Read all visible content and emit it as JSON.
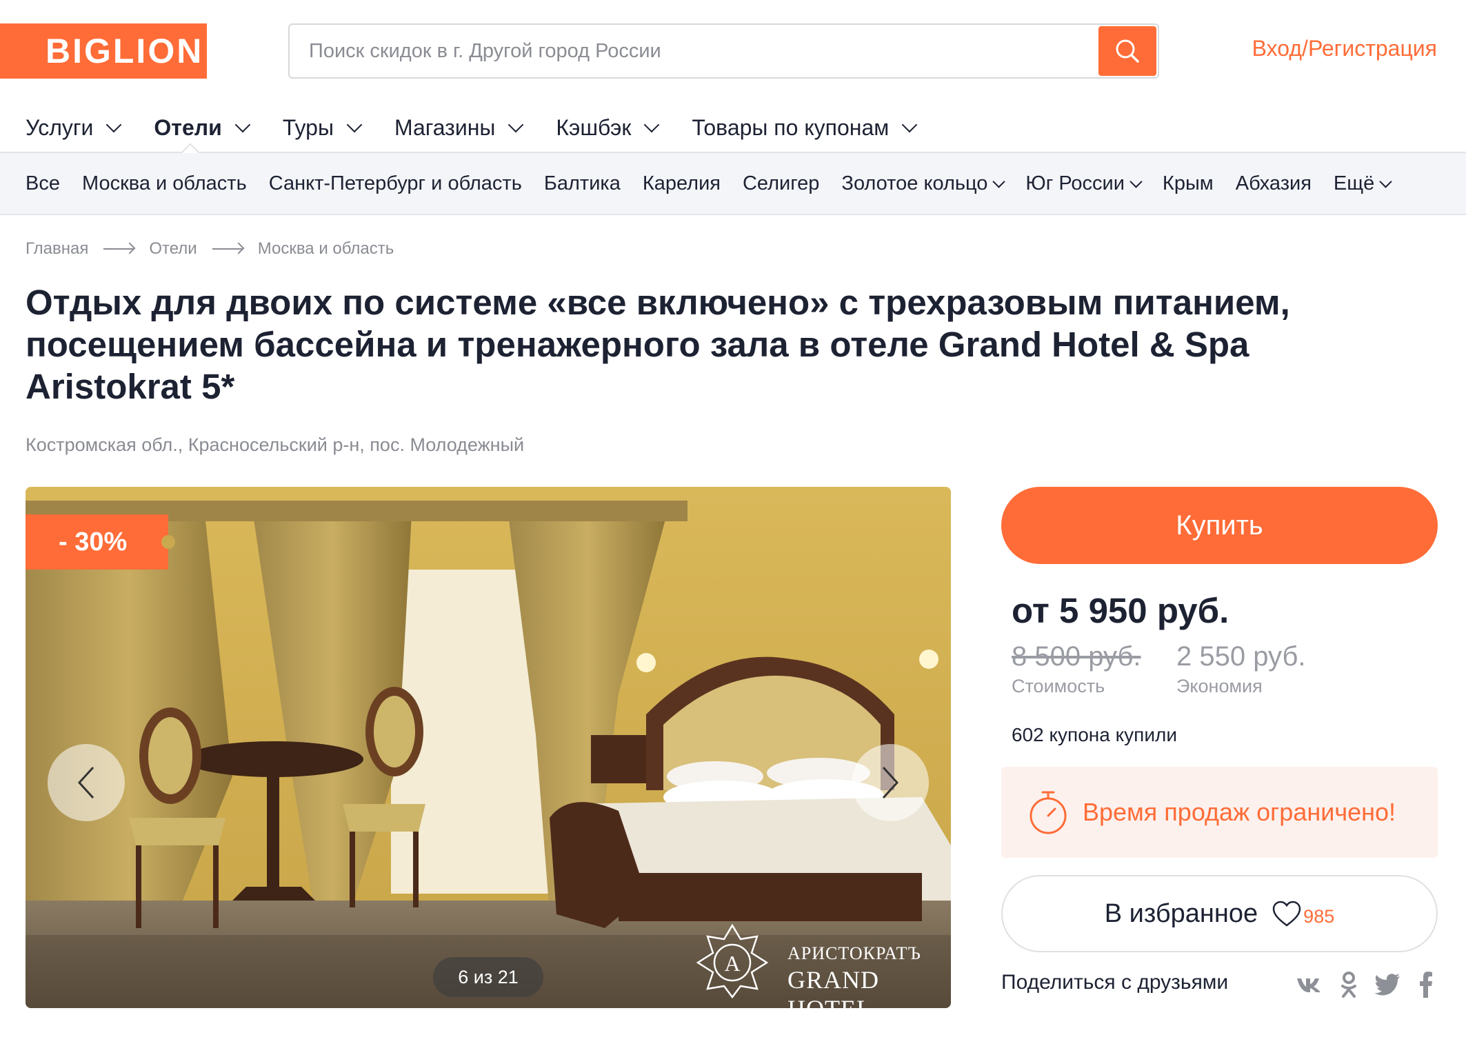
{
  "header": {
    "logo_text": "BIGLION",
    "search_placeholder": "Поиск скидок в г. Другой город России",
    "login_label": "Вход/Регистрация"
  },
  "main_nav": [
    {
      "label": "Услуги",
      "active": false
    },
    {
      "label": "Отели",
      "active": true
    },
    {
      "label": "Туры",
      "active": false
    },
    {
      "label": "Магазины",
      "active": false
    },
    {
      "label": "Кэшбэк",
      "active": false
    },
    {
      "label": "Товары по купонам",
      "active": false
    }
  ],
  "sub_nav": [
    {
      "label": "Все"
    },
    {
      "label": "Москва и область"
    },
    {
      "label": "Санкт-Петербург и область"
    },
    {
      "label": "Балтика"
    },
    {
      "label": "Карелия"
    },
    {
      "label": "Селигер"
    },
    {
      "label": "Золотое кольцо"
    },
    {
      "label": "Юг России"
    },
    {
      "label": "Крым"
    },
    {
      "label": "Абхазия"
    },
    {
      "label": "Ещё"
    }
  ],
  "breadcrumb": [
    "Главная",
    "Отели",
    "Москва и область"
  ],
  "deal": {
    "title": "Отдых для двоих по системе «все включено» с трехразовым питанием, посещением бассейна и тренажерного зала в отеле Grand Hotel & Spa Aristokrat 5*",
    "address": "Костромская обл., Красносельский р-н, пос. Молодежный",
    "discount_badge": "- 30%",
    "gallery_counter": "6 из 21",
    "watermark_line1": "АРИСТОКРАТЪ",
    "watermark_line2": "GRAND HOTEL",
    "buy_label": "Купить",
    "price": "от 5 950 руб.",
    "old_price": "8 500 руб.",
    "old_price_label": "Стоимость",
    "saving": "2 550 руб.",
    "saving_label": "Экономия",
    "bought": "602 купона купили",
    "limited_notice": "Время продаж ограничено!",
    "favorite_label": "В избранное",
    "favorite_count": "985",
    "share_label": "Поделиться с друзьями",
    "social_icons": [
      "vk-icon",
      "odnoklassniki-icon",
      "twitter-icon",
      "facebook-icon"
    ]
  },
  "colors": {
    "accent": "#ff6c37",
    "text": "#1d2233",
    "muted": "#8a8c93",
    "subnav_bg": "#f4f5f8",
    "notice_bg": "#fdf1ee"
  }
}
